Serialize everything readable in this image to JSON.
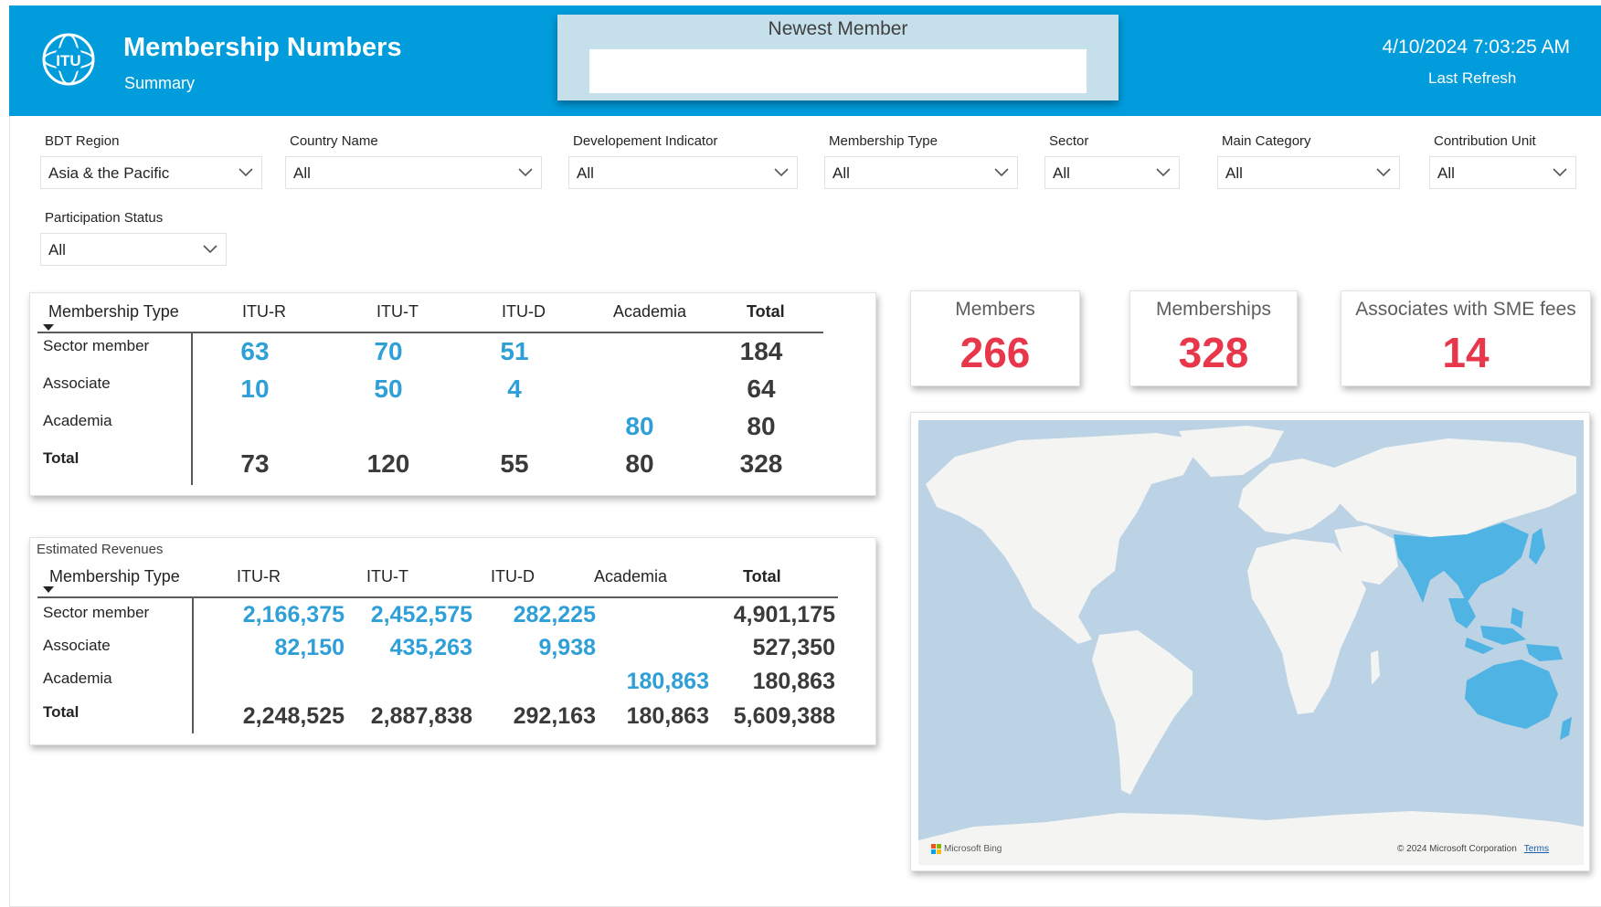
{
  "header": {
    "title": "Membership Numbers",
    "subtitle": "Summary",
    "newest_member_label": "Newest Member",
    "newest_member_value": "",
    "refresh_time": "4/10/2024 7:03:25 AM",
    "refresh_label": "Last Refresh"
  },
  "filters": [
    {
      "label": "BDT Region",
      "value": "Asia & the Pacific"
    },
    {
      "label": "Country Name",
      "value": "All"
    },
    {
      "label": "Developement Indicator",
      "value": "All"
    },
    {
      "label": "Membership Type",
      "value": "All"
    },
    {
      "label": "Sector",
      "value": "All"
    },
    {
      "label": "Main Category",
      "value": "All"
    },
    {
      "label": "Contribution Unit",
      "value": "All"
    },
    {
      "label": "Participation Status",
      "value": "All"
    }
  ],
  "counts_matrix": {
    "row_header": "Membership Type",
    "columns": [
      "ITU-R",
      "ITU-T",
      "ITU-D",
      "Academia",
      "Total"
    ],
    "rows": [
      {
        "label": "Sector member",
        "values": [
          "63",
          "70",
          "51",
          "",
          "184"
        ]
      },
      {
        "label": "Associate",
        "values": [
          "10",
          "50",
          "4",
          "",
          "64"
        ]
      },
      {
        "label": "Academia",
        "values": [
          "",
          "",
          "",
          "80",
          "80"
        ]
      },
      {
        "label": "Total",
        "values": [
          "73",
          "120",
          "55",
          "80",
          "328"
        ]
      }
    ]
  },
  "revenue_matrix": {
    "title": "Estimated Revenues",
    "row_header": "Membership Type",
    "columns": [
      "ITU-R",
      "ITU-T",
      "ITU-D",
      "Academia",
      "Total"
    ],
    "rows": [
      {
        "label": "Sector member",
        "values": [
          "2,166,375",
          "2,452,575",
          "282,225",
          "",
          "4,901,175"
        ]
      },
      {
        "label": "Associate",
        "values": [
          "82,150",
          "435,263",
          "9,938",
          "",
          "527,350"
        ]
      },
      {
        "label": "Academia",
        "values": [
          "",
          "",
          "",
          "180,863",
          "180,863"
        ]
      },
      {
        "label": "Total",
        "values": [
          "2,248,525",
          "2,887,838",
          "292,163",
          "180,863",
          "5,609,388"
        ]
      }
    ]
  },
  "kpis": [
    {
      "label": "Members",
      "value": "266"
    },
    {
      "label": "Memberships",
      "value": "328"
    },
    {
      "label": "Associates with SME fees",
      "value": "14"
    }
  ],
  "map": {
    "provider": "Microsoft Bing",
    "copyright": "© 2024 Microsoft Corporation",
    "terms": "Terms",
    "highlighted_region": "Asia & the Pacific"
  },
  "colors": {
    "header_bg": "#009cdc",
    "newest_bg": "#c5e0eb",
    "value_blue": "#2f9fd8",
    "kpi_red": "#e8374b",
    "map_water": "#bcd2e5",
    "map_land": "#f4f4f2",
    "map_highlight": "#4fb3e3"
  }
}
